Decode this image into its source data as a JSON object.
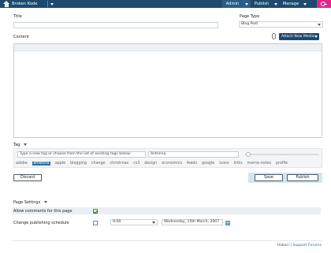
{
  "topbar": {
    "site_name": "Broken Kode",
    "admin_label": "Admin",
    "publish_label": "Publish",
    "manage_label": "Manage"
  },
  "form": {
    "title_label": "Title",
    "title_value": "",
    "page_type_label": "Page Type",
    "page_type_value": "Blog Post",
    "content_label": "Content",
    "attach_label": "Attach New Media"
  },
  "tags": {
    "label": "Tag",
    "input_placeholder": "Type a new tag or choose from the list of existing tags below:",
    "selected_value": "Antenna,",
    "list": [
      "adobe",
      "antenna",
      "apple",
      "blogging",
      "change",
      "christmas",
      "cs3",
      "design",
      "economics",
      "feeds",
      "google",
      "icons",
      "links",
      "meme-notes",
      "profile"
    ],
    "active": "antenna"
  },
  "buttons": {
    "discard": "Discard",
    "save": "Save",
    "publish": "Publish"
  },
  "settings": {
    "label": "Page Settings",
    "allow_comments_label": "Allow comments for this page",
    "allow_comments": true,
    "schedule_label": "Change publishing schedule",
    "schedule_enabled": false,
    "time_value": "9:00",
    "date_value": "Wednesday, 15th March, 2007",
    "plus_label": "+"
  },
  "footer": {
    "prefix": "Habari",
    "separator": "|",
    "support_link": "Support Forums"
  },
  "colors": {
    "topbar": "#1f4a6e",
    "accent_pink": "#e0288a",
    "tag_active": "#2f6fa6"
  }
}
